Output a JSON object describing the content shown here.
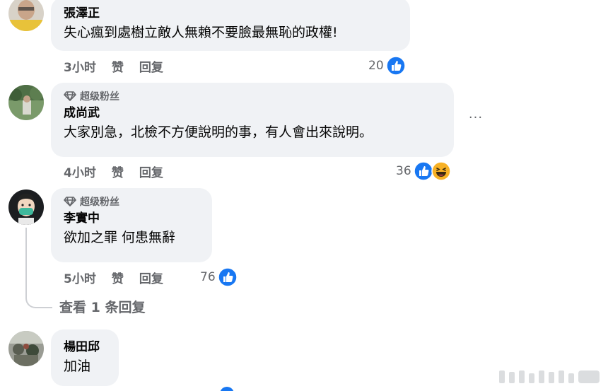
{
  "comments": [
    {
      "author": "張澤正",
      "text": "失心瘋到處樹立敵人無賴不要臉最無恥的政權!",
      "time": "3小时",
      "like_label": "赞",
      "reply_label": "回复",
      "reaction_count": "20",
      "reactions": [
        "like-icon"
      ]
    },
    {
      "badge": "超级粉丝",
      "author": "成尚武",
      "text": "大家別急，北檢不方便說明的事，有人會出來說明。",
      "time": "4小时",
      "like_label": "赞",
      "reply_label": "回复",
      "reaction_count": "36",
      "reactions": [
        "like-icon",
        "haha-icon"
      ],
      "more_label": "···"
    },
    {
      "badge": "超级粉丝",
      "author": "李實中",
      "text": "欲加之罪 何患無辭",
      "time": "5小时",
      "like_label": "赞",
      "reply_label": "回复",
      "reaction_count": "76",
      "reactions": [
        "like-icon"
      ],
      "view_replies": "查看 1 条回复"
    },
    {
      "author": "楊田邱",
      "text": "加油"
    }
  ],
  "colors": {
    "bubble": "#f0f2f5",
    "meta_text": "#65676b",
    "like_blue": "#1877f2",
    "haha_yellow": "#f7b125"
  }
}
